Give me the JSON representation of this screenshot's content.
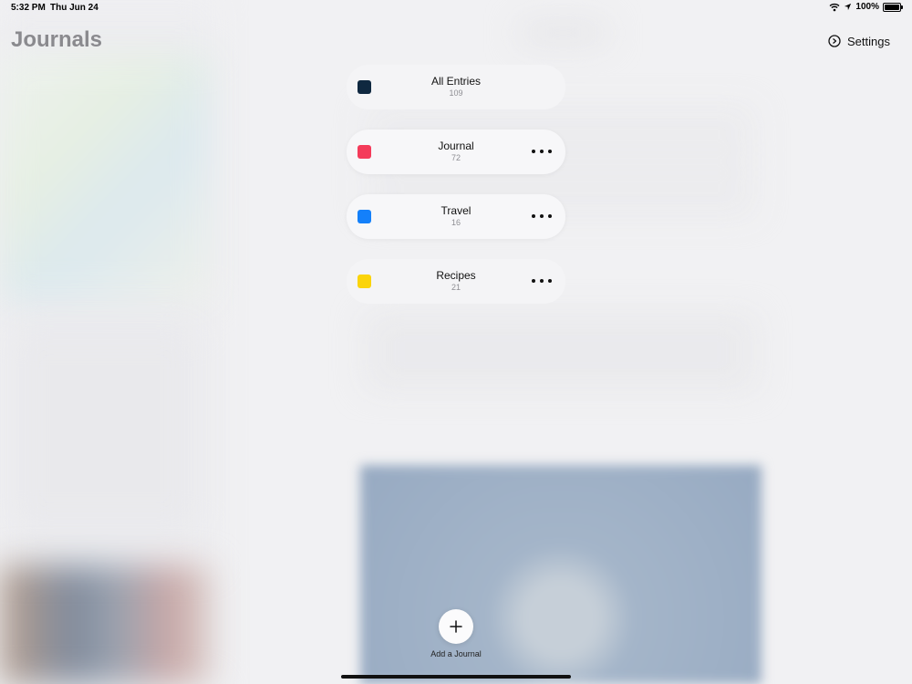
{
  "status_bar": {
    "time": "5:32 PM",
    "date": "Thu Jun 24",
    "battery": "100%",
    "icons": [
      "wifi-icon",
      "location-icon",
      "battery-icon"
    ]
  },
  "sidebar": {
    "title": "Journals"
  },
  "toolbar": {
    "settings_label": "Settings",
    "settings_icon": "settings-icon"
  },
  "journals": [
    {
      "name": "All Entries",
      "count": "109",
      "color": "#0f2840",
      "has_menu": false
    },
    {
      "name": "Journal",
      "count": "72",
      "color": "#f43b5a",
      "has_menu": true
    },
    {
      "name": "Travel",
      "count": "16",
      "color": "#1480fa",
      "has_menu": true
    },
    {
      "name": "Recipes",
      "count": "21",
      "color": "#fbd40a",
      "has_menu": true
    }
  ],
  "add_journal": {
    "label": "Add a Journal",
    "icon": "plus-icon"
  }
}
